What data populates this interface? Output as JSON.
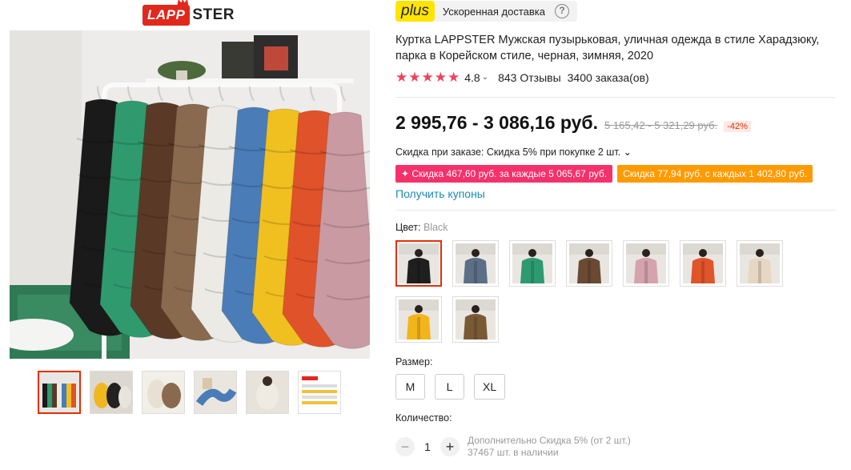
{
  "brand": {
    "logo_box": "LAPP",
    "logo_rest": "STER"
  },
  "delivery": {
    "badge": "plus",
    "text": "Ускоренная доставка",
    "help": "?"
  },
  "product": {
    "title": "Куртка LAPPSTER Мужская пузырьковая, уличная одежда в стиле Харадзюку, парка в Корейском стиле, черная, зимняя, 2020",
    "rating": "4.8",
    "stars": 5,
    "reviews": "843 Отзывы",
    "orders": "3400 заказа(ов)"
  },
  "price": {
    "current": "2 995,76 - 3 086,16 руб.",
    "old": "5 165,42 - 5 321,29 руб.",
    "discount": "-42%"
  },
  "order_discount": "Скидка при заказе: Скидка 5% при покупке 2 шт. ⌄",
  "coupons": [
    {
      "text": "✦ Скидка 467,60 руб. за каждые 5 065,67 руб.",
      "color": "#f5316b"
    },
    {
      "text": "Скидка 77,94 руб. с каждых 1 402,80 руб.",
      "color": "#ff9a00"
    }
  ],
  "get_coupons": "Получить купоны",
  "color_section": {
    "label": "Цвет: ",
    "selected": "Black"
  },
  "swatches": [
    {
      "name": "black",
      "jacket": "#1f1f1f"
    },
    {
      "name": "blue-grey",
      "jacket": "#5b6f86"
    },
    {
      "name": "green",
      "jacket": "#2e9a72"
    },
    {
      "name": "brown",
      "jacket": "#6b4a33"
    },
    {
      "name": "pink",
      "jacket": "#d4a3ad"
    },
    {
      "name": "orange",
      "jacket": "#e0542a"
    },
    {
      "name": "beige",
      "jacket": "#e6d7c2"
    },
    {
      "name": "yellow",
      "jacket": "#f2b51c"
    },
    {
      "name": "khaki",
      "jacket": "#7a5a35"
    }
  ],
  "size_section": {
    "label": "Размер:",
    "options": [
      "M",
      "L",
      "XL"
    ]
  },
  "quantity": {
    "label": "Количество:",
    "value": "1",
    "minus": "−",
    "plus": "+",
    "info_line1": "Дополнительно Скидка 5% (от 2 шт.)",
    "info_line2": "37467 шт. в наличии"
  },
  "gallery": {
    "jackets": [
      "#1a1a1a",
      "#2f9a6e",
      "#5a3a26",
      "#8a6a4e",
      "#eceae4",
      "#4a7cb8",
      "#f0c020",
      "#e0522a",
      "#c99aa2"
    ]
  }
}
